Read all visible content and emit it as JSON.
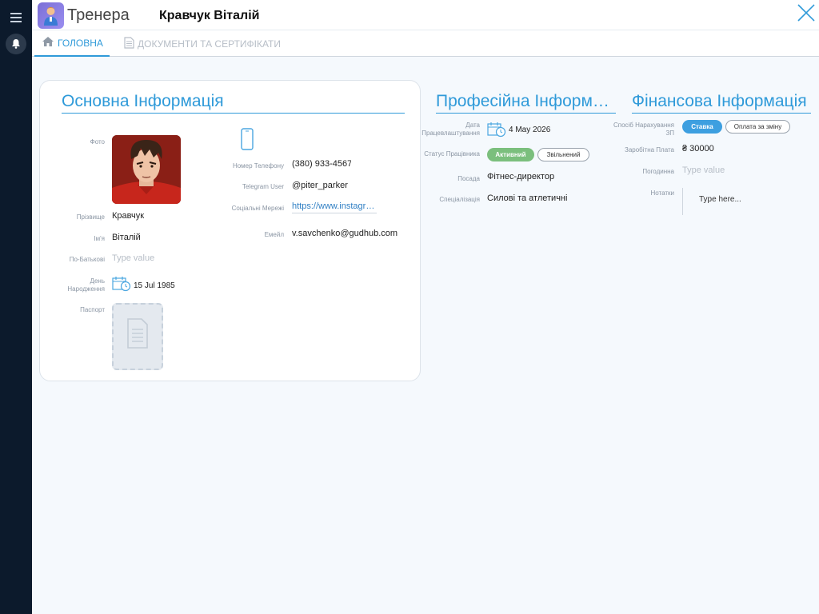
{
  "header": {
    "app_title": "Тренера",
    "record_name": "Кравчук Віталій"
  },
  "tabs": [
    {
      "label": "ГОЛОВНА",
      "active": true
    },
    {
      "label": "ДОКУМЕНТИ ТА СЕРТИФІКАТИ",
      "active": false
    }
  ],
  "basic": {
    "title": "Основна Інформація",
    "photo_label": "Фото",
    "last_name_label": "Прізвище",
    "last_name": "Кравчук",
    "first_name_label": "Ім'я",
    "first_name": "Віталій",
    "patronymic_label": "По-Батькові",
    "patronymic_placeholder": "Type value",
    "birthday_label": "День Народження",
    "birthday": "15 Jul 1985",
    "passport_label": "Паспорт",
    "phone_label": "Номер Телефону",
    "phone": "(380) 933-4567",
    "telegram_label": "Telegram User",
    "telegram": "@piter_parker",
    "social_label": "Соціальні Мережі",
    "social": "https://www.instagram.com",
    "email_label": "Емейл",
    "email": "v.savchenko@gudhub.com"
  },
  "professional": {
    "title": "Професійна Інформація",
    "hire_date_label": "Дата Працевлаштування",
    "hire_date": "4 May 2026",
    "status_label": "Статус Працівника",
    "status_options": [
      "Активний",
      "Звільнений"
    ],
    "position_label": "Посада",
    "position": "Фітнес-директор",
    "specialization_label": "Спеціалізація",
    "specialization": "Силові та атлетичні"
  },
  "financial": {
    "title": "Фінансова Інформація",
    "pay_method_label": "Спосіб Нарахування ЗП",
    "pay_method_options": [
      "Ставка",
      "Оплата за зміну"
    ],
    "salary_label": "Заробітна Плата",
    "salary": "₴ 30000",
    "hourly_label": "Погодинна",
    "hourly_placeholder": "Type value",
    "notes_label": "Нотатки",
    "notes_placeholder": "Type here..."
  },
  "colors": {
    "accent": "#2f9ad9",
    "rail": "#0c1a2c",
    "active_green": "#7bbf7d"
  },
  "icons": [
    "menu-icon",
    "bell-icon",
    "app-trainer-icon",
    "close-icon",
    "home-icon",
    "document-icon",
    "calendar-icon",
    "phone-icon",
    "passport-document-icon"
  ]
}
